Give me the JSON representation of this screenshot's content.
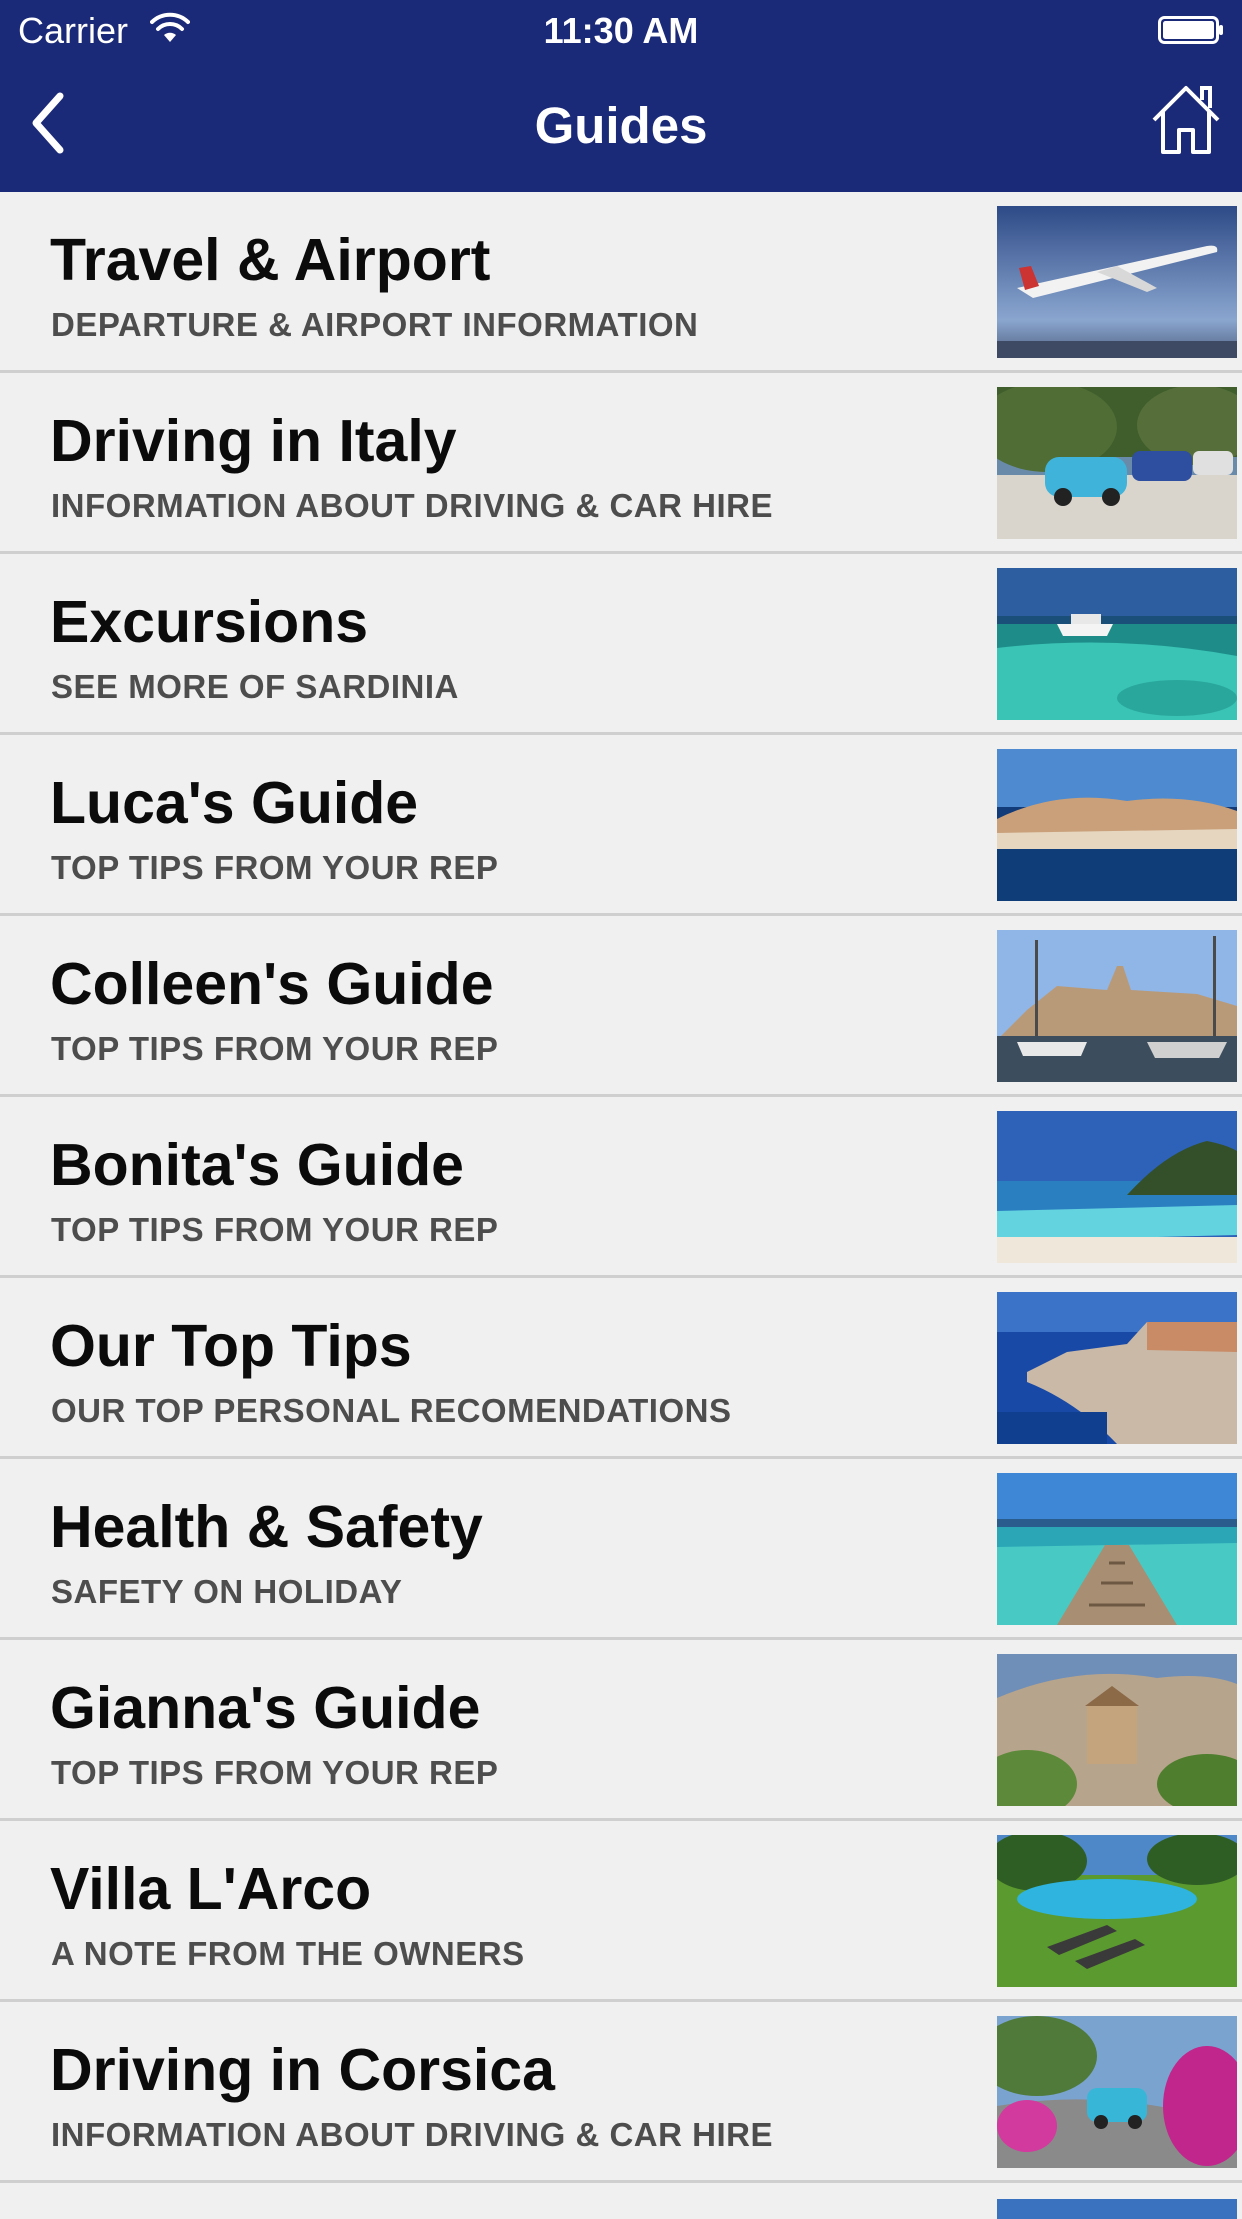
{
  "status_bar": {
    "carrier": "Carrier",
    "time": "11:30 AM"
  },
  "nav": {
    "title": "Guides",
    "back_icon": "chevron-left-icon",
    "home_icon": "home-icon",
    "background_color": "#1b2a78"
  },
  "guides": [
    {
      "title": "Travel & Airport",
      "subtitle": "DEPARTURE & AIRPORT INFORMATION",
      "thumbnail": "airplane-photo"
    },
    {
      "title": "Driving in Italy",
      "subtitle": "INFORMATION ABOUT DRIVING & CAR HIRE",
      "thumbnail": "parked-cars-photo"
    },
    {
      "title": "Excursions",
      "subtitle": "SEE MORE OF SARDINIA",
      "thumbnail": "boat-turquoise-sea-photo"
    },
    {
      "title": "Luca's Guide",
      "subtitle": "TOP TIPS FROM YOUR REP",
      "thumbnail": "coastal-town-photo"
    },
    {
      "title": "Colleen's Guide",
      "subtitle": "TOP TIPS FROM YOUR REP",
      "thumbnail": "harbour-boats-photo"
    },
    {
      "title": "Bonita's Guide",
      "subtitle": "TOP TIPS FROM YOUR REP",
      "thumbnail": "beach-headland-photo"
    },
    {
      "title": "Our Top Tips",
      "subtitle": "OUR TOP PERSONAL RECOMENDATIONS",
      "thumbnail": "cliff-town-photo"
    },
    {
      "title": "Health & Safety",
      "subtitle": "SAFETY ON HOLIDAY",
      "thumbnail": "wooden-pier-photo"
    },
    {
      "title": "Gianna's Guide",
      "subtitle": "TOP TIPS FROM YOUR REP",
      "thumbnail": "hill-town-photo"
    },
    {
      "title": "Villa L'Arco",
      "subtitle": "A NOTE FROM THE OWNERS",
      "thumbnail": "villa-pool-photo"
    },
    {
      "title": "Driving in Corsica",
      "subtitle": "INFORMATION ABOUT DRIVING & CAR HIRE",
      "thumbnail": "coastal-road-flowers-photo"
    }
  ]
}
